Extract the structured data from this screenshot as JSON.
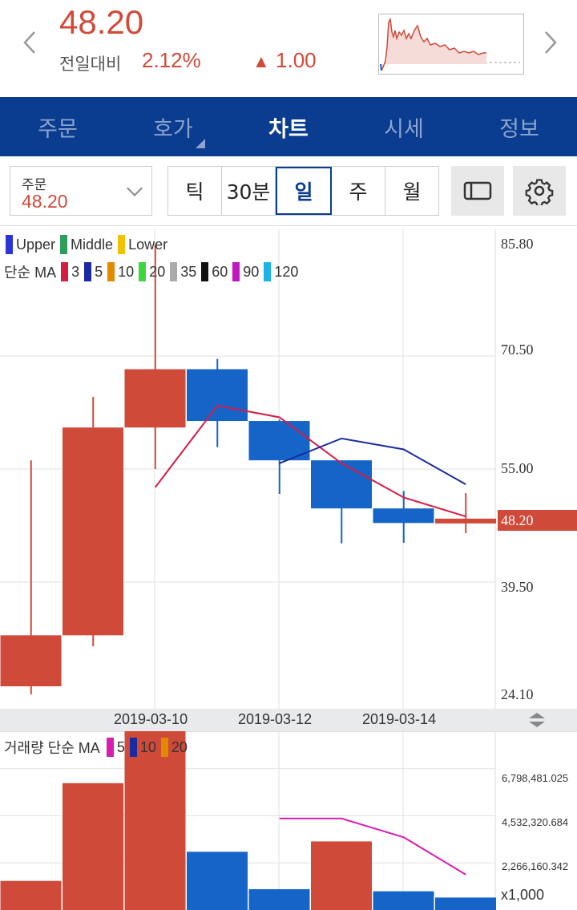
{
  "header": {
    "price": "48.20",
    "change_label": "전일대비",
    "change_pct": "2.12%",
    "change_arrow": "▲",
    "change_amt": "1.00"
  },
  "tabs": [
    "주문",
    "호가",
    "차트",
    "시세",
    "정보"
  ],
  "active_tab": "차트",
  "toolbar": {
    "order_label": "주문",
    "order_value": "48.20",
    "periods": [
      "틱",
      "30분",
      "일",
      "주",
      "월"
    ],
    "selected_period": "일"
  },
  "legend_bands": [
    {
      "name": "Upper",
      "color": "#2b34d6"
    },
    {
      "name": "Middle",
      "color": "#2e9e5b"
    },
    {
      "name": "Lower",
      "color": "#f2c200"
    }
  ],
  "ma_legend": {
    "label": "단순 MA",
    "items": [
      {
        "name": "3",
        "color": "#d81b45"
      },
      {
        "name": "5",
        "color": "#1a2aa0"
      },
      {
        "name": "10",
        "color": "#e08a00"
      },
      {
        "name": "20",
        "color": "#3ed63e"
      },
      {
        "name": "35",
        "color": "#aaaaaa"
      },
      {
        "name": "60",
        "color": "#111111"
      },
      {
        "name": "90",
        "color": "#c017c0"
      },
      {
        "name": "120",
        "color": "#1ab4e6"
      }
    ]
  },
  "volume_legend": {
    "label": "거래량 단순 MA",
    "items": [
      {
        "name": "5",
        "color": "#d61fb0"
      },
      {
        "name": "10",
        "color": "#1a2aa0"
      },
      {
        "name": "20",
        "color": "#e08a00"
      }
    ]
  },
  "colors": {
    "up": "#d04a3a",
    "down": "#1565c8",
    "accent": "#0a3d8f"
  },
  "chart_data": [
    {
      "type": "candlestick",
      "y_ticks": [
        "85.80",
        "70.50",
        "55.00",
        "39.50",
        "24.10"
      ],
      "ylim": [
        24.1,
        85.8
      ],
      "x_tick_labels": [
        "2019-03-10",
        "2019-03-12",
        "2019-03-14"
      ],
      "current_price": "48.20",
      "candles": [
        {
          "open": 25.2,
          "close": 32.2,
          "high": 56.2,
          "low": 24.1
        },
        {
          "open": 32.2,
          "close": 60.7,
          "high": 64.9,
          "low": 30.7
        },
        {
          "open": 60.7,
          "close": 68.7,
          "high": 85.8,
          "low": 55.0
        },
        {
          "open": 68.7,
          "close": 61.6,
          "high": 70.1,
          "low": 58.0
        },
        {
          "open": 61.6,
          "close": 56.2,
          "high": 61.8,
          "low": 51.6
        },
        {
          "open": 56.2,
          "close": 49.6,
          "high": 56.2,
          "low": 44.8
        },
        {
          "open": 49.6,
          "close": 47.6,
          "high": 52.0,
          "low": 44.9
        },
        {
          "open": 47.6,
          "close": 48.2,
          "high": 51.7,
          "low": 46.2
        }
      ],
      "ma3": [
        null,
        null,
        52.5,
        63.7,
        62.1,
        55.8,
        51.1,
        48.5
      ],
      "ma5": [
        null,
        null,
        null,
        null,
        55.8,
        59.2,
        57.7,
        52.9
      ]
    },
    {
      "type": "bar",
      "title": "volume",
      "y_ticks": [
        "6,798,481.025",
        "4,532,320.684",
        "2,266,160.342"
      ],
      "unit": "x1,000",
      "values": [
        1400000,
        6100000,
        8600000,
        2800000,
        1000000,
        3300000,
        900000,
        600000
      ],
      "directions": [
        "up",
        "up",
        "up",
        "down",
        "down",
        "up",
        "down",
        "down"
      ],
      "ma5": [
        null,
        null,
        null,
        null,
        4400000,
        4400000,
        3500000,
        1700000
      ]
    }
  ]
}
